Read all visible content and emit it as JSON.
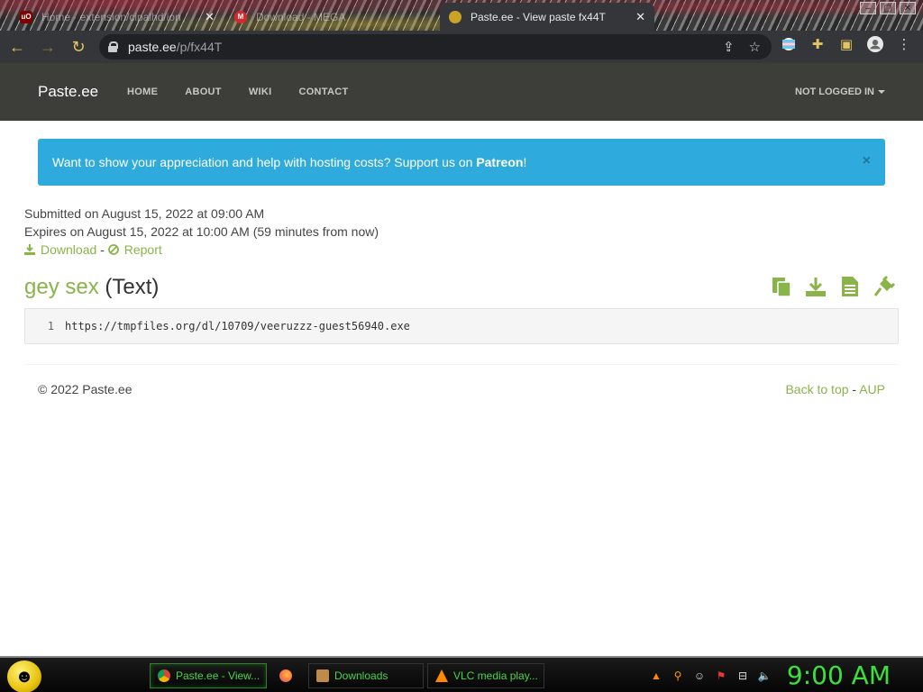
{
  "browser": {
    "tabs": [
      {
        "title": "Home · extension/cipalhd/ion",
        "favicon": "ublock-icon",
        "active": false
      },
      {
        "title": "Download - MEGA",
        "favicon": "mega-icon",
        "active": false
      },
      {
        "title": "Paste.ee - View paste fx44T",
        "favicon": "pasteee-icon",
        "active": true
      }
    ],
    "url_host": "paste.ee",
    "url_path": "/p/fx44T"
  },
  "site": {
    "brand": "Paste.ee",
    "nav": [
      "HOME",
      "ABOUT",
      "WIKI",
      "CONTACT"
    ],
    "login": "NOT LOGGED IN"
  },
  "alert": {
    "text": "Want to show your appreciation and help with hosting costs? Support us on ",
    "link": "Patreon",
    "suffix": "!",
    "close": "×"
  },
  "paste": {
    "submitted": "Submitted on August 15, 2022 at 09:00 AM",
    "expires": "Expires on August 15, 2022 at 10:00 AM (59 minutes from now)",
    "download": "Download",
    "link_sep": "-",
    "report": "Report",
    "name": "gey sex",
    "type": "(Text)",
    "line_number": "1",
    "content": "https://tmpfiles.org/dl/10709/veeruzzz-guest56940.exe"
  },
  "footer": {
    "copyright": "© 2022 Paste.ee",
    "back_to_top": "Back to top",
    "sep": "-",
    "aup": "AUP"
  },
  "taskbar": {
    "items": [
      {
        "label": "Paste.ee - View...",
        "icon": "chrome-icon",
        "active": true
      },
      {
        "label": "",
        "icon": "firefox-icon",
        "active": false
      },
      {
        "label": "Downloads",
        "icon": "folder-icon",
        "active": false
      },
      {
        "label": "VLC media play...",
        "icon": "vlc-icon",
        "active": false
      }
    ],
    "clock": "9:00 AM"
  },
  "colors": {
    "accent_green": "#8ab34a",
    "alert_blue": "#2eaadc",
    "navbar": "#3d3d3a",
    "clock_green": "#3ce03c"
  }
}
